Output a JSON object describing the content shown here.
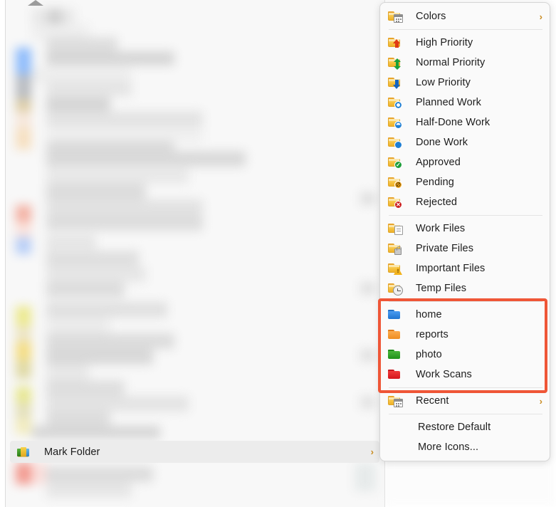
{
  "context_menu": {
    "name": "folder-icon-context-menu",
    "groups": [
      {
        "id": "colors",
        "items": [
          {
            "label": "Colors",
            "icon": "folder-colors-icon",
            "submenu": true,
            "chevron": "›"
          }
        ]
      },
      {
        "id": "priority-status",
        "items": [
          {
            "label": "High Priority",
            "icon": "folder-arrow-up-icon"
          },
          {
            "label": "Normal Priority",
            "icon": "folder-arrow-updown-icon"
          },
          {
            "label": "Low Priority",
            "icon": "folder-arrow-down-icon"
          },
          {
            "label": "Planned Work",
            "icon": "folder-circle-empty-icon"
          },
          {
            "label": "Half-Done Work",
            "icon": "folder-circle-half-icon"
          },
          {
            "label": "Done Work",
            "icon": "folder-circle-full-icon"
          },
          {
            "label": "Approved",
            "icon": "folder-check-icon"
          },
          {
            "label": "Pending",
            "icon": "folder-pending-icon"
          },
          {
            "label": "Rejected",
            "icon": "folder-rejected-icon"
          }
        ]
      },
      {
        "id": "file-kinds",
        "items": [
          {
            "label": "Work Files",
            "icon": "folder-document-icon"
          },
          {
            "label": "Private Files",
            "icon": "folder-lock-icon"
          },
          {
            "label": "Important Files",
            "icon": "folder-warning-icon"
          },
          {
            "label": "Temp Files",
            "icon": "folder-clock-icon"
          }
        ]
      },
      {
        "id": "custom-folders",
        "highlighted": true,
        "items": [
          {
            "label": "home",
            "icon": "folder-blue-icon",
            "color": "#2f86e0"
          },
          {
            "label": "reports",
            "icon": "folder-orange-icon",
            "color": "#f29333"
          },
          {
            "label": "photo",
            "icon": "folder-green-icon",
            "color": "#2fa526"
          },
          {
            "label": "Work Scans",
            "icon": "folder-red-icon",
            "color": "#e8222a"
          }
        ]
      },
      {
        "id": "recent",
        "items": [
          {
            "label": "Recent",
            "icon": "folder-recent-icon",
            "submenu": true,
            "chevron": "›"
          }
        ]
      },
      {
        "id": "actions",
        "items": [
          {
            "label": "Restore Default",
            "icon": null
          },
          {
            "label": "More Icons...",
            "icon": null
          }
        ]
      }
    ]
  },
  "parent_menu": {
    "item": {
      "label": "Mark Folder",
      "icon": "mark-folder-icon",
      "chevron": "›",
      "state": "hovered"
    }
  },
  "colors": {
    "highlight_box": "#ef5637",
    "menu_background": "#fafafa",
    "menu_border": "#d6d6d6",
    "hover_background": "#ececec",
    "text": "#1d1d1d",
    "separator": "#e4e4e4",
    "chevron": "#c98a1e"
  }
}
